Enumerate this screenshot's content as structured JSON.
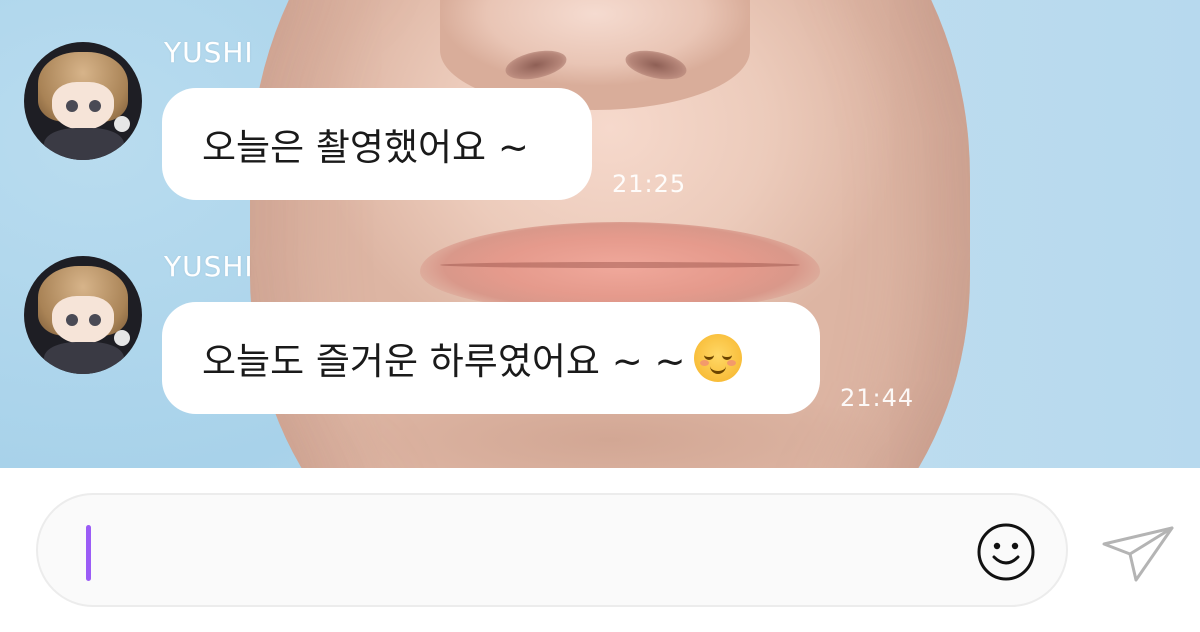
{
  "messages": [
    {
      "sender": "YUSHI",
      "text": "오늘은 촬영했어요 ~",
      "time": "21:25",
      "emoji": ""
    },
    {
      "sender": "YUSHI",
      "text": "오늘도 즐거운 하루였어요 ~ ~",
      "time": "21:44",
      "emoji": "smiling-face-icon"
    }
  ],
  "composer": {
    "value": "",
    "placeholder": "",
    "cursor_color": "#9B5CF6",
    "emoji_button_icon": "smiley-icon",
    "send_button_icon": "paper-plane-icon"
  }
}
